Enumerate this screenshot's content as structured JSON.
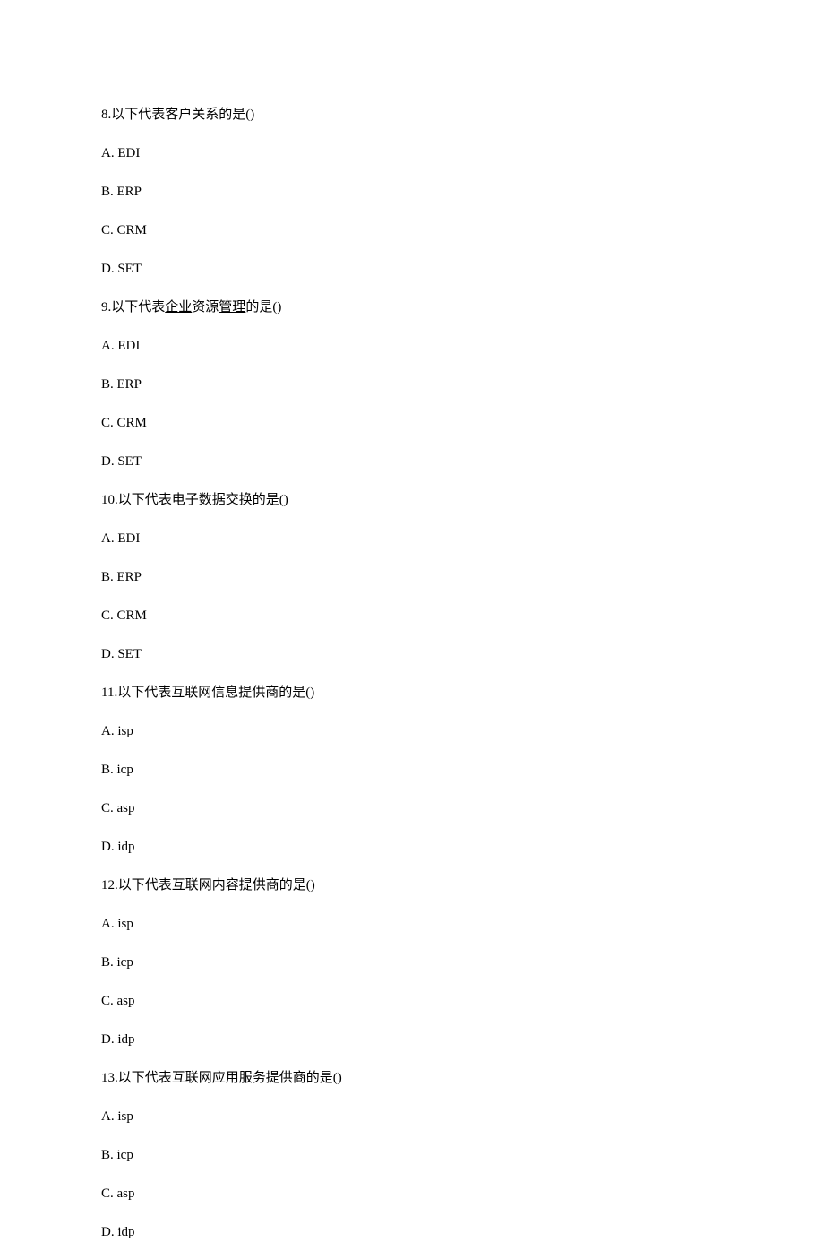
{
  "questions": [
    {
      "number": "8",
      "text_before_underline": ".以下代表客户关系的是(",
      "underline": "",
      "text_after_underline": "",
      "blank": "      ",
      "text_end": ")",
      "options": [
        "A. EDI",
        "B. ERP",
        "C. CRM",
        "D. SET"
      ]
    },
    {
      "number": "9",
      "text_before_underline": ".以下代表",
      "underline": "企业",
      "text_mid": "资源",
      "underline2": "管理",
      "text_after_underline": "的是(",
      "blank": "      ",
      "text_end": ")",
      "options": [
        "A. EDI",
        "B. ERP",
        "C. CRM",
        "D. SET"
      ]
    },
    {
      "number": "10",
      "text_before_underline": ".以下代表电子数据交换的是(",
      "underline": "",
      "text_after_underline": "",
      "blank": "      ",
      "text_end": ")",
      "options": [
        "A. EDI",
        "B. ERP",
        "C. CRM",
        "D. SET"
      ]
    },
    {
      "number": "11",
      "text_before_underline": ".以下代表互联网信息提供商的是(",
      "underline": "",
      "text_after_underline": "",
      "blank": "      ",
      "text_end": ")",
      "options": [
        "A. isp",
        "B. icp",
        "C. asp",
        "D. idp"
      ]
    },
    {
      "number": "12",
      "text_before_underline": ".以下代表互联网内容提供商的是(",
      "underline": "",
      "text_after_underline": "",
      "blank": "      ",
      "text_end": ")",
      "options": [
        "A. isp",
        "B. icp",
        "C. asp",
        "D. idp"
      ]
    },
    {
      "number": "13",
      "text_before_underline": ".以下代表互联网应用服务提供商的是(",
      "underline": "",
      "text_after_underline": "",
      "blank": "      ",
      "text_end": ")",
      "options": [
        "A. isp",
        "B. icp",
        "C. asp",
        "D. idp"
      ]
    }
  ]
}
